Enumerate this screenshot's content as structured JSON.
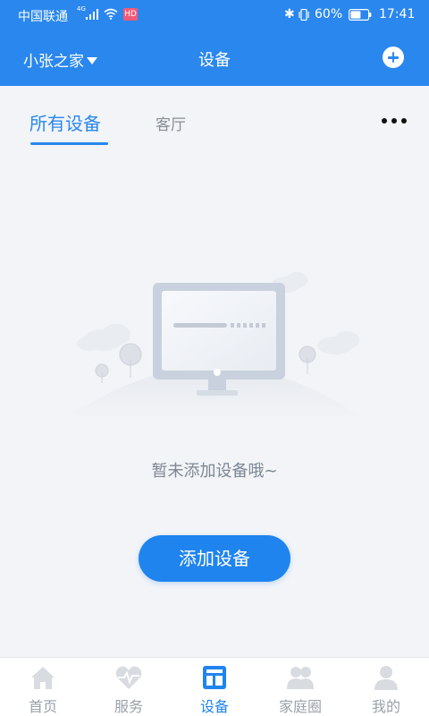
{
  "status_bar": {
    "carrier": "中国联通",
    "network": "4G",
    "hd_badge": "HD",
    "battery_pct": "60%",
    "battery_level": 0.6,
    "time": "17:41"
  },
  "header": {
    "home_name": "小张之家",
    "title": "设备"
  },
  "tabs": [
    {
      "label": "所有设备",
      "active": true
    },
    {
      "label": "客厅",
      "active": false
    }
  ],
  "empty_state": {
    "message": "暂未添加设备哦~",
    "button_label": "添加设备"
  },
  "bottom_nav": [
    {
      "label": "首页",
      "icon": "home-icon",
      "active": false
    },
    {
      "label": "服务",
      "icon": "heartbeat-icon",
      "active": false
    },
    {
      "label": "设备",
      "icon": "device-icon",
      "active": true
    },
    {
      "label": "家庭圈",
      "icon": "family-icon",
      "active": false
    },
    {
      "label": "我的",
      "icon": "user-icon",
      "active": false
    }
  ],
  "colors": {
    "primary": "#2a87ee",
    "background": "#f2f4f7",
    "inactive": "#9aa1a9",
    "muted_text": "#7d8794"
  }
}
